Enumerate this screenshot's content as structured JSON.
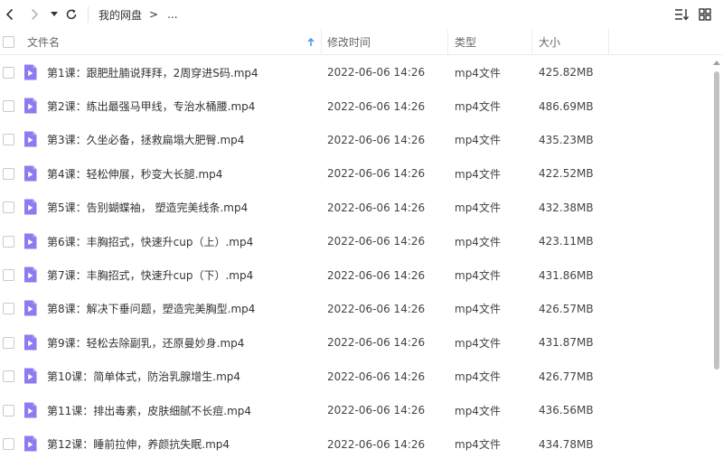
{
  "toolbar": {
    "breadcrumb": [
      "我的网盘",
      ">",
      "..."
    ]
  },
  "columns": {
    "name": "文件名",
    "time": "修改时间",
    "type": "类型",
    "size": "大小"
  },
  "sort": {
    "column": "name",
    "direction": "ascending"
  },
  "icons": {
    "back": "chevron-left-icon",
    "forward": "chevron-right-icon",
    "history": "caret-down-icon",
    "refresh": "refresh-icon",
    "sort_view": "sort-list-icon",
    "grid_view": "grid-icon",
    "file": "video-file-icon"
  },
  "colors": {
    "file_icon": "#8c7cf0",
    "sort_arrow": "#3a8ee6"
  },
  "files": [
    {
      "name": "第1课：跟肥肚腩说拜拜，2周穿进S码.mp4",
      "time": "2022-06-06 14:26",
      "type": "mp4文件",
      "size": "425.82MB"
    },
    {
      "name": "第2课：练出最强马甲线，专治水桶腰.mp4",
      "time": "2022-06-06 14:26",
      "type": "mp4文件",
      "size": "486.69MB"
    },
    {
      "name": "第3课：久坐必备，拯救扁塌大肥臀.mp4",
      "time": "2022-06-06 14:26",
      "type": "mp4文件",
      "size": "435.23MB"
    },
    {
      "name": "第4课：轻松伸展，秒变大长腿.mp4",
      "time": "2022-06-06 14:26",
      "type": "mp4文件",
      "size": "422.52MB"
    },
    {
      "name": "第5课：告别蝴蝶袖， 塑造完美线条.mp4",
      "time": "2022-06-06 14:26",
      "type": "mp4文件",
      "size": "432.38MB"
    },
    {
      "name": "第6课：丰胸招式，快速升cup（上）.mp4",
      "time": "2022-06-06 14:26",
      "type": "mp4文件",
      "size": "423.11MB"
    },
    {
      "name": "第7课：丰胸招式，快速升cup（下）.mp4",
      "time": "2022-06-06 14:26",
      "type": "mp4文件",
      "size": "431.86MB"
    },
    {
      "name": "第8课：解决下垂问题，塑造完美胸型.mp4",
      "time": "2022-06-06 14:26",
      "type": "mp4文件",
      "size": "426.57MB"
    },
    {
      "name": "第9课：轻松去除副乳，还原曼妙身.mp4",
      "time": "2022-06-06 14:26",
      "type": "mp4文件",
      "size": "431.87MB"
    },
    {
      "name": "第10课：简单体式，防治乳腺增生.mp4",
      "time": "2022-06-06 14:26",
      "type": "mp4文件",
      "size": "426.77MB"
    },
    {
      "name": "第11课：排出毒素，皮肤细腻不长痘.mp4",
      "time": "2022-06-06 14:26",
      "type": "mp4文件",
      "size": "436.56MB"
    },
    {
      "name": "第12课：睡前拉伸，养颜抗失眠.mp4",
      "time": "2022-06-06 14:26",
      "type": "mp4文件",
      "size": "434.78MB"
    }
  ]
}
